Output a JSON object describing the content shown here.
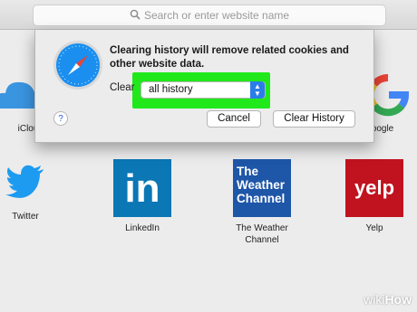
{
  "addressbar": {
    "placeholder": "Search or enter website name"
  },
  "favorites": [
    {
      "label": "iCloud"
    },
    {
      "label": "Google"
    },
    {
      "label": "Twitter"
    },
    {
      "label": "LinkedIn"
    },
    {
      "label": "The Weather Channel",
      "logo_text": "The Weather Channel"
    },
    {
      "label": "Yelp",
      "logo_text": "yelp"
    }
  ],
  "dialog": {
    "message": "Clearing history will remove related cookies and other website data.",
    "clear_label": "Clear",
    "select_value": "all history",
    "help": "?",
    "cancel_label": "Cancel",
    "confirm_label": "Clear History",
    "highlight_color": "#21e81a"
  },
  "watermark": {
    "prefix": "wiki",
    "suffix": "How"
  }
}
